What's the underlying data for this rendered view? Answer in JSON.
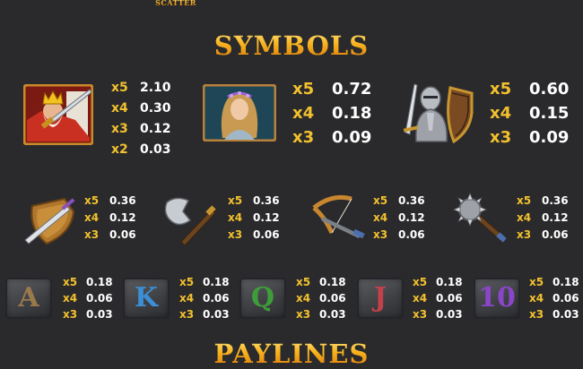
{
  "header": {
    "scatter_label": "SCATTER"
  },
  "symbols_title": "SYMBOLS",
  "paylines_title": "PAYLINES",
  "premium": [
    {
      "name": "king",
      "pays": [
        {
          "m": "x5",
          "v": "2.10"
        },
        {
          "m": "x4",
          "v": "0.30"
        },
        {
          "m": "x3",
          "v": "0.12"
        },
        {
          "m": "x2",
          "v": "0.03"
        }
      ]
    },
    {
      "name": "queen",
      "pays": [
        {
          "m": "x5",
          "v": "0.72"
        },
        {
          "m": "x4",
          "v": "0.18"
        },
        {
          "m": "x3",
          "v": "0.09"
        }
      ]
    },
    {
      "name": "knight",
      "pays": [
        {
          "m": "x5",
          "v": "0.60"
        },
        {
          "m": "x4",
          "v": "0.15"
        },
        {
          "m": "x3",
          "v": "0.09"
        }
      ]
    }
  ],
  "weapons": [
    {
      "name": "shield-sword",
      "pays": [
        {
          "m": "x5",
          "v": "0.36"
        },
        {
          "m": "x4",
          "v": "0.12"
        },
        {
          "m": "x3",
          "v": "0.06"
        }
      ]
    },
    {
      "name": "axe",
      "pays": [
        {
          "m": "x5",
          "v": "0.36"
        },
        {
          "m": "x4",
          "v": "0.12"
        },
        {
          "m": "x3",
          "v": "0.06"
        }
      ]
    },
    {
      "name": "crossbow",
      "pays": [
        {
          "m": "x5",
          "v": "0.36"
        },
        {
          "m": "x4",
          "v": "0.12"
        },
        {
          "m": "x3",
          "v": "0.06"
        }
      ]
    },
    {
      "name": "mace",
      "pays": [
        {
          "m": "x5",
          "v": "0.36"
        },
        {
          "m": "x4",
          "v": "0.12"
        },
        {
          "m": "x3",
          "v": "0.06"
        }
      ]
    }
  ],
  "letters": [
    {
      "glyph": "A",
      "color": "#9a7a4c",
      "pays": [
        {
          "m": "x5",
          "v": "0.18"
        },
        {
          "m": "x4",
          "v": "0.06"
        },
        {
          "m": "x3",
          "v": "0.03"
        }
      ]
    },
    {
      "glyph": "K",
      "color": "#3c8fd6",
      "pays": [
        {
          "m": "x5",
          "v": "0.18"
        },
        {
          "m": "x4",
          "v": "0.06"
        },
        {
          "m": "x3",
          "v": "0.03"
        }
      ]
    },
    {
      "glyph": "Q",
      "color": "#3f9c3a",
      "pays": [
        {
          "m": "x5",
          "v": "0.18"
        },
        {
          "m": "x4",
          "v": "0.06"
        },
        {
          "m": "x3",
          "v": "0.03"
        }
      ]
    },
    {
      "glyph": "J",
      "color": "#c2414b",
      "pays": [
        {
          "m": "x5",
          "v": "0.18"
        },
        {
          "m": "x4",
          "v": "0.06"
        },
        {
          "m": "x3",
          "v": "0.03"
        }
      ]
    },
    {
      "glyph": "10",
      "color": "#8a45c8",
      "pays": [
        {
          "m": "x5",
          "v": "0.18"
        },
        {
          "m": "x4",
          "v": "0.06"
        },
        {
          "m": "x3",
          "v": "0.03"
        }
      ]
    }
  ],
  "colors": {
    "background": "#2a2a2c",
    "multiplier": "#f2c12e",
    "value": "#ffffff",
    "title_gold": "#f6a623"
  }
}
